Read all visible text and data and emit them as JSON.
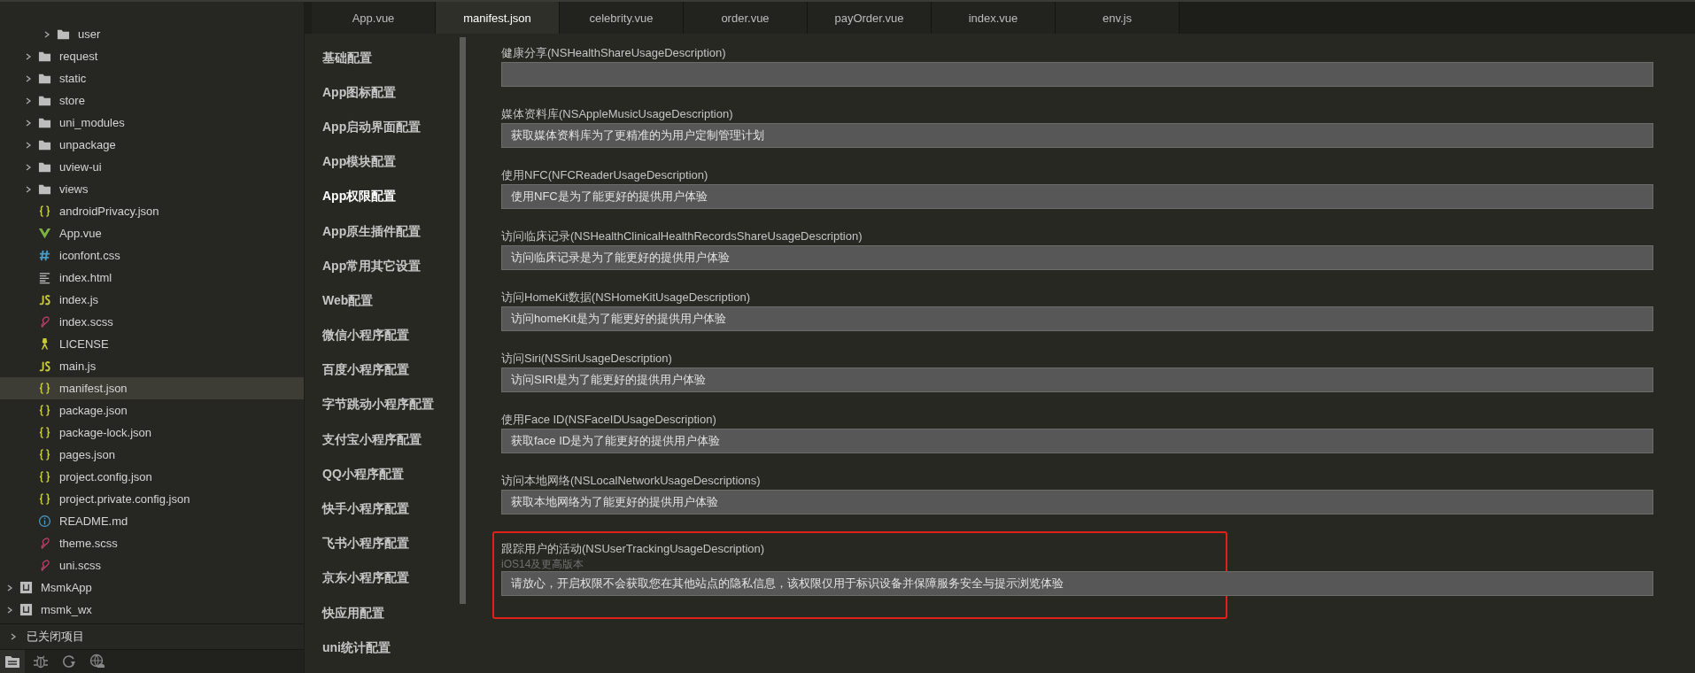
{
  "explorer": {
    "tree": [
      {
        "children": [
          {
            "children": [
              {
                "name": "user",
                "kind": "folder",
                "expanded": false,
                "selected": false
              }
            ]
          },
          {
            "name": "request",
            "kind": "folder",
            "expanded": false,
            "selected": false
          },
          {
            "name": "static",
            "kind": "folder",
            "expanded": false,
            "selected": false
          },
          {
            "name": "store",
            "kind": "folder",
            "expanded": false,
            "selected": false
          },
          {
            "name": "uni_modules",
            "kind": "folder",
            "expanded": false,
            "selected": false
          },
          {
            "name": "unpackage",
            "kind": "folder",
            "expanded": false,
            "selected": false
          },
          {
            "name": "uview-ui",
            "kind": "folder",
            "expanded": false,
            "selected": false
          },
          {
            "name": "views",
            "kind": "folder",
            "expanded": false,
            "selected": false
          },
          {
            "name": "androidPrivacy.json",
            "kind": "json",
            "selected": false
          },
          {
            "name": "App.vue",
            "kind": "vue",
            "selected": false
          },
          {
            "name": "iconfont.css",
            "kind": "css",
            "selected": false
          },
          {
            "name": "index.html",
            "kind": "html",
            "selected": false
          },
          {
            "name": "index.js",
            "kind": "js",
            "selected": false
          },
          {
            "name": "index.scss",
            "kind": "scss",
            "selected": false
          },
          {
            "name": "LICENSE",
            "kind": "license",
            "selected": false
          },
          {
            "name": "main.js",
            "kind": "js",
            "selected": false
          },
          {
            "name": "manifest.json",
            "kind": "json",
            "selected": true
          },
          {
            "name": "package.json",
            "kind": "json",
            "selected": false
          },
          {
            "name": "package-lock.json",
            "kind": "json",
            "selected": false
          },
          {
            "name": "pages.json",
            "kind": "json",
            "selected": false
          },
          {
            "name": "project.config.json",
            "kind": "json",
            "selected": false
          },
          {
            "name": "project.private.config.json",
            "kind": "json",
            "selected": false
          },
          {
            "name": "README.md",
            "kind": "md",
            "selected": false
          },
          {
            "name": "theme.scss",
            "kind": "scss",
            "selected": false
          },
          {
            "name": "uni.scss",
            "kind": "scss",
            "selected": false
          }
        ]
      },
      {
        "name": "MsmkApp",
        "kind": "project",
        "expanded": false,
        "selected": false
      },
      {
        "name": "msmk_wx",
        "kind": "project",
        "expanded": false,
        "selected": false
      }
    ],
    "closed_projects": {
      "label": "已关闭项目",
      "expanded": false
    },
    "toolbar": [
      {
        "kind": "files",
        "selected": true
      },
      {
        "kind": "debug",
        "selected": false
      },
      {
        "kind": "sync",
        "selected": false
      },
      {
        "kind": "cloud",
        "selected": false
      }
    ]
  },
  "tabs": [
    {
      "label": "App.vue",
      "selected": false
    },
    {
      "label": "manifest.json",
      "selected": true
    },
    {
      "label": "celebrity.vue",
      "selected": false
    },
    {
      "label": "order.vue",
      "selected": false
    },
    {
      "label": "payOrder.vue",
      "selected": false
    },
    {
      "label": "index.vue",
      "selected": false
    },
    {
      "label": "env.js",
      "selected": false
    }
  ],
  "nav": [
    {
      "label": "基础配置",
      "selected": false
    },
    {
      "label": "App图标配置",
      "selected": false
    },
    {
      "label": "App启动界面配置",
      "selected": false
    },
    {
      "label": "App模块配置",
      "selected": false
    },
    {
      "label": "App权限配置",
      "selected": true
    },
    {
      "label": "App原生插件配置",
      "selected": false
    },
    {
      "label": "App常用其它设置",
      "selected": false
    },
    {
      "label": "Web配置",
      "selected": false
    },
    {
      "label": "微信小程序配置",
      "selected": false
    },
    {
      "label": "百度小程序配置",
      "selected": false
    },
    {
      "label": "字节跳动小程序配置",
      "selected": false
    },
    {
      "label": "支付宝小程序配置",
      "selected": false
    },
    {
      "label": "QQ小程序配置",
      "selected": false
    },
    {
      "label": "快手小程序配置",
      "selected": false
    },
    {
      "label": "飞书小程序配置",
      "selected": false
    },
    {
      "label": "京东小程序配置",
      "selected": false
    },
    {
      "label": "快应用配置",
      "selected": false
    },
    {
      "label": "uni统计配置",
      "selected": false
    }
  ],
  "permissions": [
    {
      "label": "健康分享(NSHealthShareUsageDescription)",
      "highlighted": false
    },
    {
      "label": "媒体资料库(NSAppleMusicUsageDescription)",
      "value": "获取媒体资料库为了更精准的为用户定制管理计划",
      "highlighted": false
    },
    {
      "label": "使用NFC(NFCReaderUsageDescription)",
      "value": "使用NFC是为了能更好的提供用户体验",
      "highlighted": false
    },
    {
      "label": "访问临床记录(NSHealthClinicalHealthRecordsShareUsageDescription)",
      "value": "访问临床记录是为了能更好的提供用户体验",
      "highlighted": false
    },
    {
      "label": "访问HomeKit数据(NSHomeKitUsageDescription)",
      "value": "访问homeKit是为了能更好的提供用户体验",
      "highlighted": false
    },
    {
      "label": "访问Siri(NSSiriUsageDescription)",
      "value": "访问SIRI是为了能更好的提供用户体验",
      "highlighted": false
    },
    {
      "label": "使用Face ID(NSFaceIDUsageDescription)",
      "value": "获取face ID是为了能更好的提供用户体验",
      "highlighted": false
    },
    {
      "label": "访问本地网络(NSLocalNetworkUsageDescriptions)",
      "value": "获取本地网络为了能更好的提供用户体验",
      "highlighted": false
    },
    {
      "label": "跟踪用户的活动(NSUserTrackingUsageDescription)",
      "hint": "iOS14及更高版本",
      "value": "请放心，开启权限不会获取您在其他站点的隐私信息，该权限仅用于标识设备并保障服务安全与提示浏览体验",
      "highlighted": true
    }
  ]
}
